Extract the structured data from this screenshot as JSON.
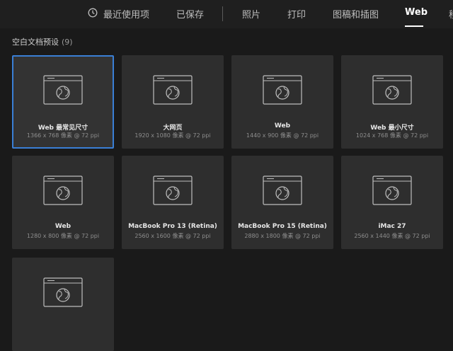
{
  "tabs": [
    {
      "label": "最近使用项",
      "active": false
    },
    {
      "label": "已保存",
      "active": false
    },
    {
      "label": "照片",
      "active": false
    },
    {
      "label": "打印",
      "active": false
    },
    {
      "label": "图稿和插图",
      "active": false
    },
    {
      "label": "Web",
      "active": true
    },
    {
      "label": "移",
      "active": false
    }
  ],
  "section": {
    "title": "空白文档预设",
    "count": "(9)"
  },
  "presets": [
    {
      "name": "Web 最常见尺寸",
      "dims": "1366 x 768 像素 @ 72 ppi",
      "selected": true
    },
    {
      "name": "大网页",
      "dims": "1920 x 1080 像素 @ 72 ppi",
      "selected": false
    },
    {
      "name": "Web",
      "dims": "1440 x 900 像素 @ 72 ppi",
      "selected": false
    },
    {
      "name": "Web 最小尺寸",
      "dims": "1024 x 768 像素 @ 72 ppi",
      "selected": false
    },
    {
      "name": "Web",
      "dims": "1280 x 800 像素 @ 72 ppi",
      "selected": false
    },
    {
      "name": "MacBook Pro 13 (Retina)",
      "dims": "2560 x 1600 像素 @ 72 ppi",
      "selected": false
    },
    {
      "name": "MacBook Pro 15 (Retina)",
      "dims": "2880 x 1800 像素 @ 72 ppi",
      "selected": false
    },
    {
      "name": "iMac 27",
      "dims": "2560 x 1440 像素 @ 72 ppi",
      "selected": false
    },
    {
      "name": "",
      "dims": "",
      "selected": false
    }
  ],
  "colors": {
    "background": "#1a1a1a",
    "card": "#2e2e2e",
    "selection": "#3a7fd6",
    "text": "#e6e6e6",
    "muted": "#8e8e8e"
  },
  "icons": {
    "recent": "clock-icon",
    "preset": "web-document-globe-icon"
  }
}
